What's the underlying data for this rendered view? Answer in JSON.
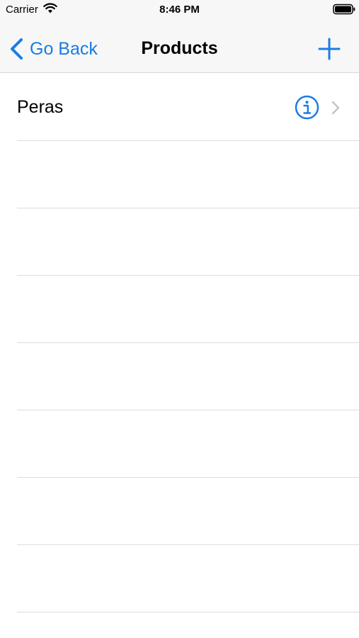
{
  "status_bar": {
    "carrier": "Carrier",
    "time": "8:46 PM",
    "icons": [
      "wifi-icon",
      "battery-icon"
    ]
  },
  "nav_bar": {
    "back_label": "Go Back",
    "title": "Products",
    "add_icon": "plus-icon"
  },
  "table": {
    "rows": [
      {
        "label": "Peras",
        "accessories": [
          "info-icon",
          "chevron-right-icon"
        ]
      }
    ],
    "empty_rows": 8
  },
  "colors": {
    "accent": "#1a7de2",
    "bar_background": "#f7f7f7",
    "separator": "#dcdcde",
    "disclosure": "#c4c4c7"
  }
}
